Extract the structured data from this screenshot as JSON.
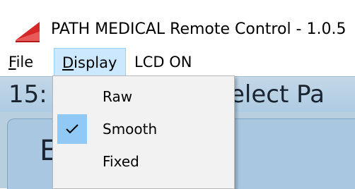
{
  "window": {
    "title": "PATH MEDICAL Remote Control  -  1.0.5",
    "logo_icon": "path-medical-logo-icon",
    "logo_color": "#e03030"
  },
  "menubar": {
    "file": {
      "label": "File",
      "accel": "F",
      "rest": "ile"
    },
    "display": {
      "label": "Display",
      "accel": "D",
      "rest": "isplay"
    },
    "lcd": {
      "label": "LCD ON"
    }
  },
  "display_menu": {
    "items": [
      {
        "label": "Raw",
        "checked": false
      },
      {
        "label": "Smooth",
        "checked": true,
        "icon": "check-icon"
      },
      {
        "label": "Fixed",
        "checked": false
      }
    ]
  },
  "device": {
    "clock": "15:",
    "screen_title": "elect Pa",
    "content_letter": "E"
  },
  "colors": {
    "menu_highlight": "#cce8ff",
    "check_highlight": "#90c8f6",
    "app_background": "#b8cfe0"
  }
}
